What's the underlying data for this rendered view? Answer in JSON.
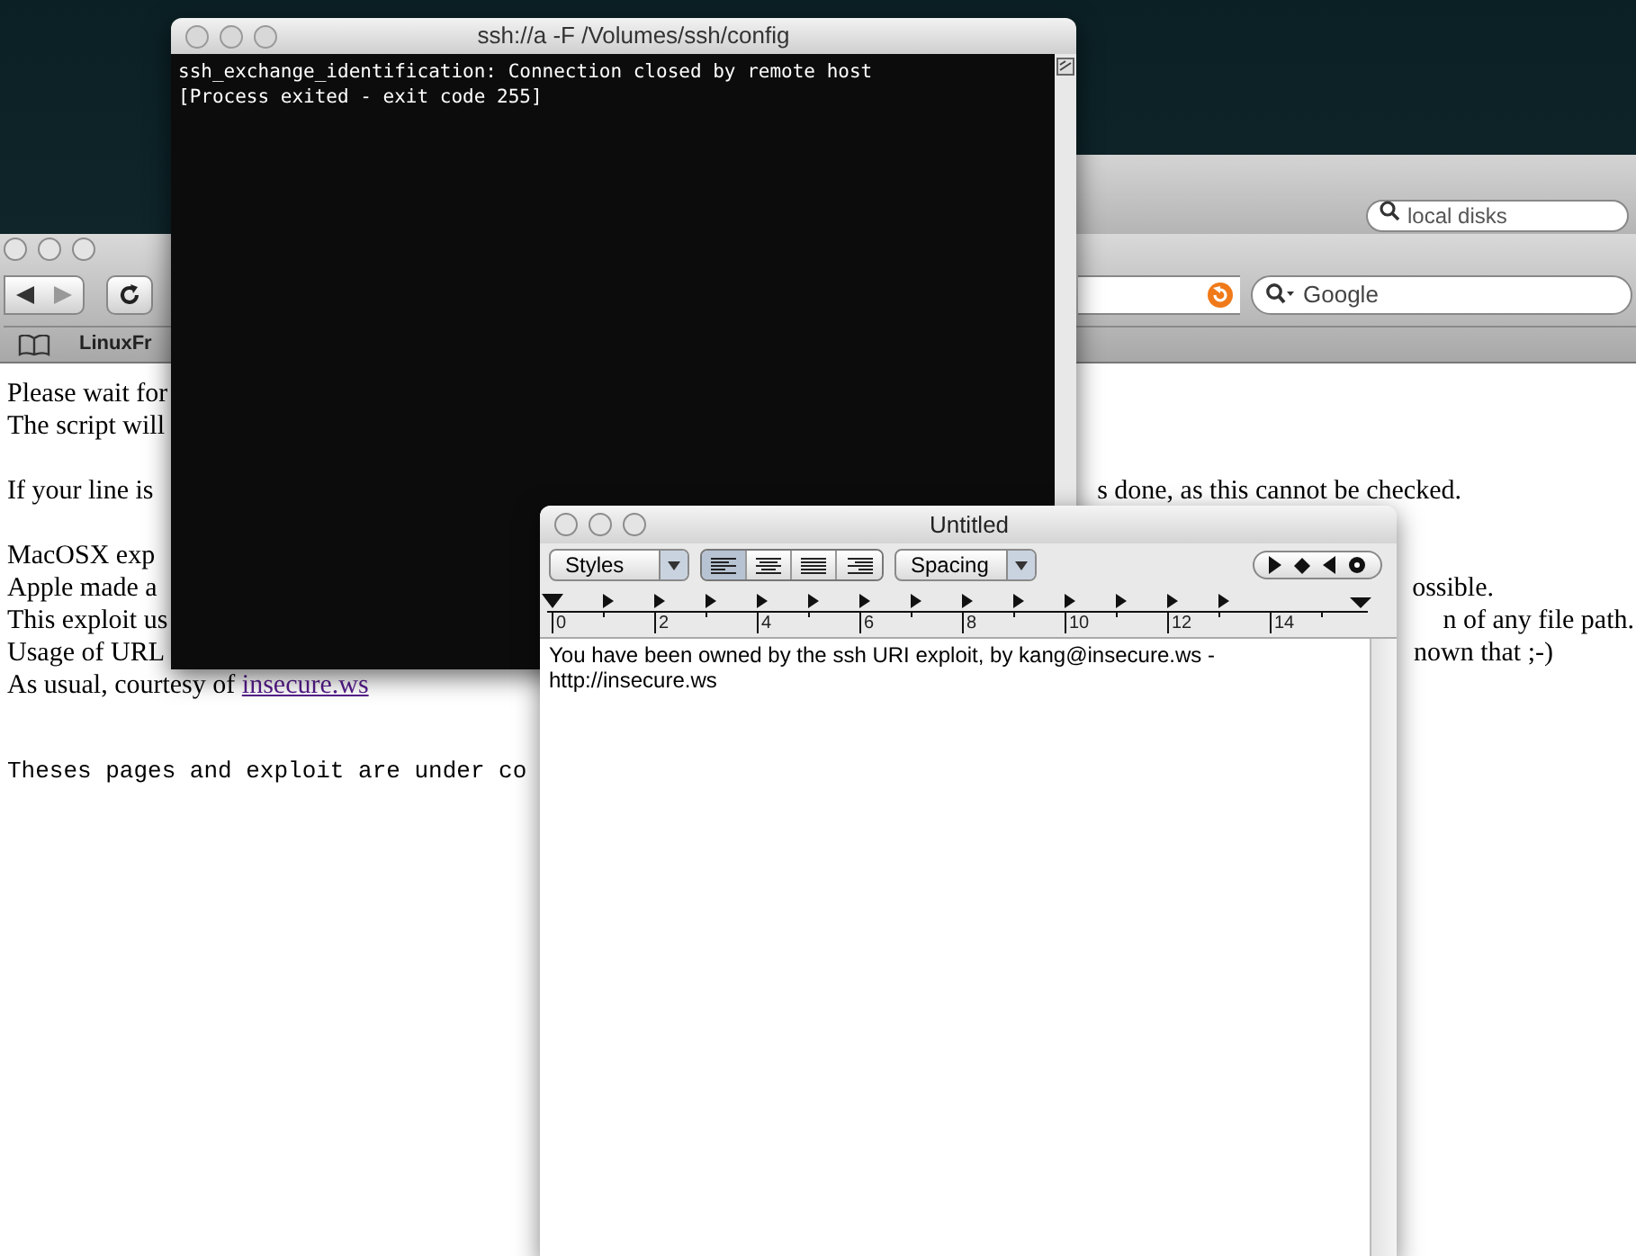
{
  "desktop": {
    "finder_search": {
      "placeholder": "local disks"
    }
  },
  "browser": {
    "search": {
      "placeholder": "Google"
    },
    "bookmarks": [
      "LinuxFr"
    ],
    "lines": [
      {
        "kind": "text",
        "left": "Please wait for"
      },
      {
        "kind": "text",
        "left": "The script will"
      },
      {
        "kind": "blank"
      },
      {
        "kind": "text",
        "left": "If your line is",
        "right": "s done, as this cannot be checked."
      },
      {
        "kind": "blank"
      },
      {
        "kind": "text",
        "left": "MacOSX exp"
      },
      {
        "kind": "text",
        "left": "Apple made a",
        "right": "ossible."
      },
      {
        "kind": "text",
        "left": "This exploit us",
        "right": "n of any file path."
      },
      {
        "kind": "text",
        "left": "Usage of URL",
        "right": "nown that ;-)"
      },
      {
        "kind": "text",
        "left": "As usual, courtesy of",
        "link": "insecure.ws"
      },
      {
        "kind": "mono",
        "left": "Theses pages and exploit are under co"
      }
    ]
  },
  "terminal": {
    "title": "ssh://a -F /Volumes/ssh/config",
    "lines": [
      "ssh_exchange_identification: Connection closed by remote host",
      "[Process exited - exit code 255]"
    ]
  },
  "textedit": {
    "title": "Untitled",
    "styles": "Styles",
    "spacing": "Spacing",
    "alignment": [
      {
        "kind": "left",
        "selected": true
      },
      {
        "kind": "center",
        "selected": false
      },
      {
        "kind": "justify",
        "selected": false
      },
      {
        "kind": "right",
        "selected": false
      }
    ],
    "ruler_labels": [
      "0",
      "2",
      "4",
      "6",
      "8",
      "10",
      "12",
      "14"
    ],
    "body": "You have been owned by the ssh URI exploit, by kang@insecure.ws - http://insecure.ws"
  }
}
